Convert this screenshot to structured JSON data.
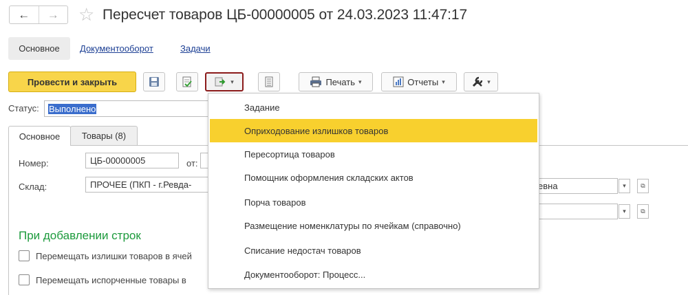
{
  "header": {
    "back_icon": "←",
    "forward_icon": "→",
    "star_icon": "☆",
    "title": "Пересчет товаров ЦБ-00000005 от 24.03.2023 11:47:17"
  },
  "top_tabs": {
    "active": "Основное",
    "links": [
      "Документооборот",
      "Задачи"
    ]
  },
  "toolbar": {
    "post_close": "Провести и закрыть",
    "print": "Печать",
    "reports": "Отчеты"
  },
  "status": {
    "label": "Статус:",
    "value": "Выполнено"
  },
  "inner_tabs": [
    "Основное",
    "Товары (8)"
  ],
  "form": {
    "number_label": "Номер:",
    "number_value": "ЦБ-00000005",
    "date_label": "от:",
    "warehouse_label": "Склад:",
    "warehouse_value": "ПРОЧЕЕ (ПКП - г.Ревда-",
    "responsible_value_tail": "евна"
  },
  "section": {
    "heading": "При добавлении строк",
    "checkbox1": "Перемещать излишки товаров в ячей",
    "checkbox2": "Перемещать испорченные товары в"
  },
  "menu": {
    "items": [
      "Задание",
      "Оприходование излишков товаров",
      "Пересортица товаров",
      "Помощник оформления складских актов",
      "Порча товаров",
      "Размещение номенклатуры по ячейкам (справочно)",
      "Списание недостач товаров",
      "Документооборот: Процесс..."
    ],
    "highlighted_index": 1
  },
  "colors": {
    "primary_button": "#f8d54a",
    "highlight": "#f8d02e",
    "link": "#1c3f94",
    "section_heading": "#1c9a3c",
    "selected_status": "#3a6dcc",
    "active_outline": "#8b1a1a"
  }
}
